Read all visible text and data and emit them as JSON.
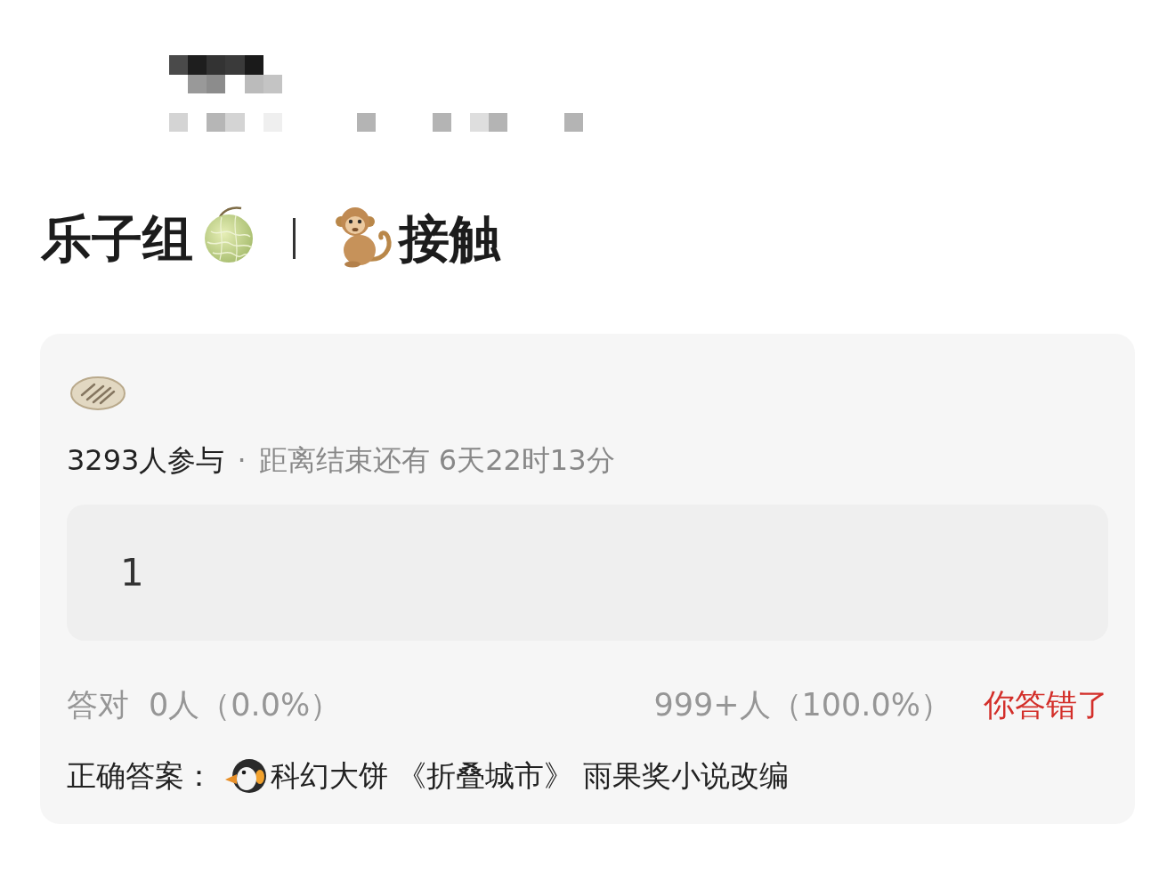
{
  "post": {
    "title": {
      "left": "乐子组",
      "right": "接触"
    }
  },
  "quiz": {
    "participants": "3293人参与",
    "separator": "·",
    "time_left": "距离结束还有 6天22时13分",
    "options": [
      {
        "label": "1"
      }
    ],
    "stats": {
      "correct_label": "答对",
      "correct_count": "0人（0.0%）",
      "wrong_count": "999+人（100.0%）"
    },
    "result": {
      "kind": "wrong",
      "text": "你答错了"
    },
    "answer": {
      "label": "正确答案：",
      "text": "科幻大饼 《折叠城市》 雨果奖小说改编"
    }
  }
}
